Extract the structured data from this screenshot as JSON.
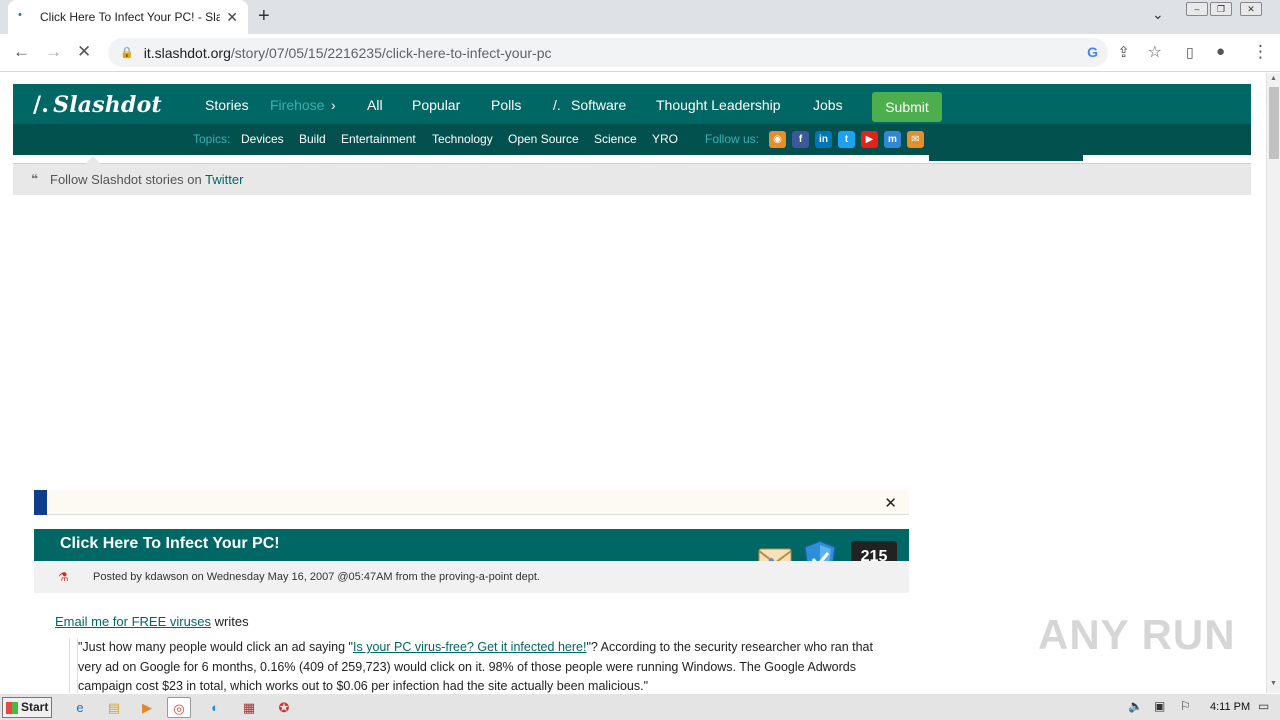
{
  "browser": {
    "tab_title": "Click Here To Infect Your PC! - Slashd",
    "url_host": "it.slashdot.org",
    "url_path": "/story/07/05/15/2216235/click-here-to-infect-your-pc"
  },
  "nav": {
    "logo": "Slashdot",
    "links": [
      "Stories",
      "Firehose",
      "All",
      "Popular",
      "Polls",
      "Software",
      "Thought Leadership",
      "Jobs"
    ],
    "submit": "Submit"
  },
  "subnav": {
    "topics_label": "Topics:",
    "topics": [
      "Devices",
      "Build",
      "Entertainment",
      "Technology",
      "Open Source",
      "Science",
      "YRO"
    ],
    "follow_label": "Follow us:",
    "social_icons": [
      "rss-icon",
      "facebook-icon",
      "linkedin-icon",
      "twitter-icon",
      "youtube-icon",
      "mastodon-icon",
      "email-icon"
    ]
  },
  "follow_bar": {
    "text": "Follow Slashdot stories on",
    "link": "Twitter"
  },
  "story": {
    "title": "Click Here To Infect Your PC!",
    "posted_by": "Posted by kdawson on Wednesday May 16, 2007 @05:47AM from the proving-a-point dept.",
    "comments": "215",
    "submitter_link": "Email me for FREE viruses",
    "submitter_suffix": "writes",
    "body_pre": "\"Just how many people would click an ad saying \"",
    "body_link": "Is your PC virus-free? Get it infected here!",
    "body_post": "\"? According to the security researcher who ran that very ad on Google for 6 months, 0.16% (409 of 259,723) would click on it. 98% of those people were running Windows. The Google Adwords campaign cost $23 in total, which works out to $0.06 per infection had the site actually been malicious.\""
  },
  "watermark": "ANY RUN",
  "taskbar": {
    "start": "Start",
    "clock": "4:11 PM"
  },
  "colors": {
    "brand": "#016765",
    "brand_dark": "#03514f",
    "submit": "#4cae4c"
  }
}
